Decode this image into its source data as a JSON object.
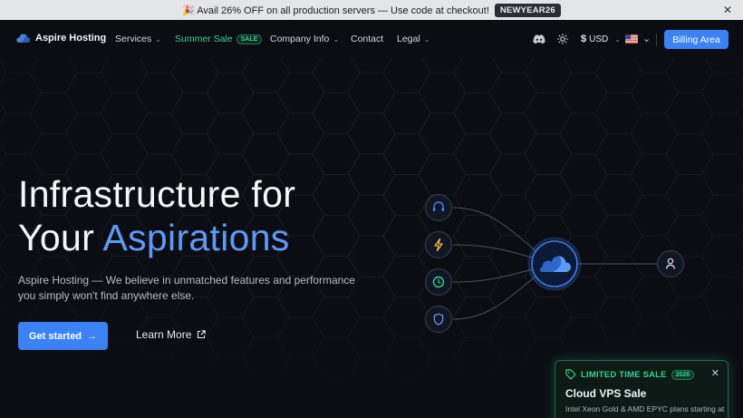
{
  "announcement": {
    "text": "🎉 Avail 26% OFF on all production servers — Use code at checkout!",
    "code": "NEWYEAR26",
    "close_icon": "close-icon"
  },
  "nav": {
    "logo_text": "Aspire Hosting",
    "items": [
      {
        "label": "Services"
      },
      {
        "label": "Summer Sale",
        "badge": "SALE"
      },
      {
        "label": "Company Info"
      },
      {
        "label": "Contact"
      },
      {
        "label": "Legal"
      }
    ],
    "currency_symbol": "$",
    "currency_code": "USD",
    "billing_label": "Billing Area"
  },
  "hero": {
    "title_line1": "Infrastructure for",
    "title_line2_plain": "Your ",
    "title_line2_accent": "Aspirations",
    "subtitle": "Aspire Hosting — We believe in unmatched features and performance you simply won't find anywhere else.",
    "cta_primary": "Get started",
    "cta_secondary": "Learn More"
  },
  "diagram": {
    "nodes": [
      "headset-icon",
      "bolt-icon",
      "clock-icon",
      "shield-icon"
    ],
    "center": "cloud-icon",
    "target": "user-icon"
  },
  "promo": {
    "label": "LIMITED TIME SALE",
    "year": "2026",
    "title": "Cloud VPS Sale",
    "desc": "Intel Xeon Gold & AMD EPYC plans starting at"
  },
  "colors": {
    "accent": "#3b82f6",
    "sale": "#34d399",
    "background": "#0b0d12"
  }
}
